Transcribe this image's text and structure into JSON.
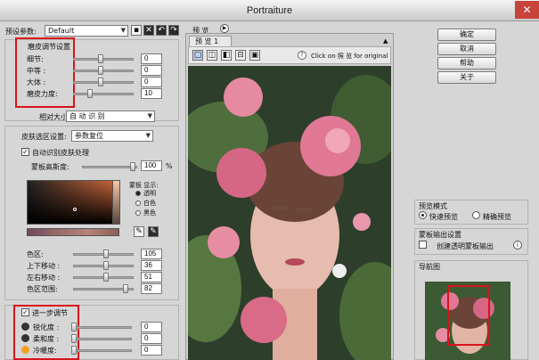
{
  "window": {
    "title": "Portraiture",
    "close_glyph": "✕"
  },
  "preset": {
    "label": "预设参数:",
    "value": "Default"
  },
  "smoothing": {
    "title": "磨皮调节设置",
    "rows": [
      {
        "label": "细节:",
        "value": "0",
        "pos": 0.45
      },
      {
        "label": "中等 :",
        "value": "0",
        "pos": 0.45
      },
      {
        "label": "大体 :",
        "value": "0",
        "pos": 0.45
      },
      {
        "label": "磨皮力度:",
        "value": "10",
        "pos": 0.25
      }
    ],
    "size_label": "相对大小:",
    "size_value": "自 动 识 别"
  },
  "mask": {
    "label": "皮肤选区设置:",
    "value": "参数复位",
    "auto_label": "自动识别皮肤处理",
    "blur_label": "蒙板高斯度:",
    "blur_value": "100",
    "blur_unit": "%",
    "display_title": "蒙板 显示:",
    "display_options": [
      "透明",
      "白色",
      "黑色"
    ],
    "rows": [
      {
        "label": "色区:",
        "value": "105",
        "pos": 0.55
      },
      {
        "label": "上下移动 :",
        "value": "36",
        "pos": 0.55
      },
      {
        "label": "左右移动 :",
        "value": "51",
        "pos": 0.55
      },
      {
        "label": "色区范围:",
        "value": "82",
        "pos": 0.9
      }
    ]
  },
  "enhance": {
    "title": "进一步调节",
    "rows": [
      {
        "label": "锐化度 :",
        "value": "0",
        "pos": 0.0
      },
      {
        "label": "柔和度 :",
        "value": "0",
        "pos": 0.0
      },
      {
        "label": "冷暖度:",
        "value": "0",
        "pos": 0.0
      }
    ]
  },
  "preview": {
    "panel_title": "预 览",
    "tab_label": "预 览 1",
    "hint": "Click on 照 览 for original"
  },
  "buttons": {
    "ok": "确定",
    "cancel": "取消",
    "help": "帮助",
    "about": "关于"
  },
  "preview_mode": {
    "title": "预览模式",
    "options": [
      "快速预览",
      "精确预览"
    ]
  },
  "output": {
    "title": "蒙板输出设置",
    "checkbox": "创建透明蒙板输出",
    "info_glyph": "i"
  },
  "navigator": {
    "title": "导航图"
  },
  "colors": {
    "highlight": "#d8141d",
    "panel": "#d6d6d6"
  }
}
